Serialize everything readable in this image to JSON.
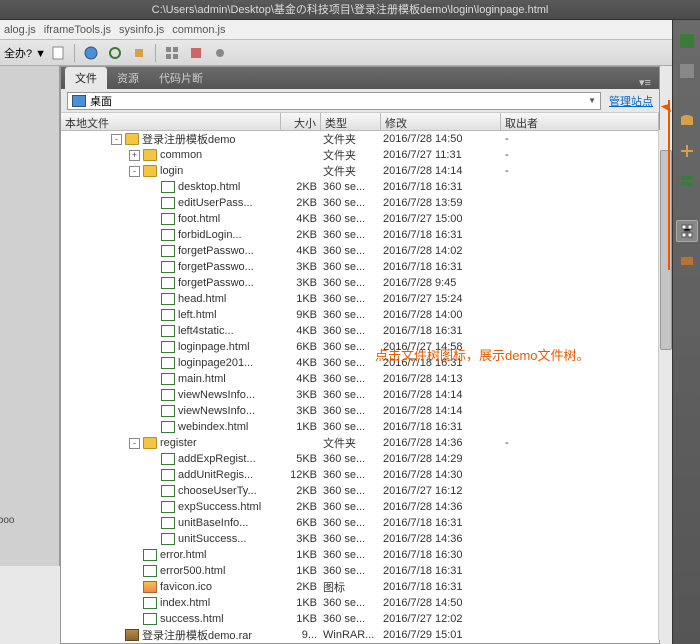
{
  "title_path": "C:\\Users\\admin\\Desktop\\基金の科技项目\\登录注册模板demo\\login\\loginpage.html",
  "open_files": [
    "alog.js",
    "iframeTools.js",
    "sysinfo.js",
    "common.js"
  ],
  "left_fragment": "全办? ▼",
  "left_bottom_fragment": "-login-boo",
  "panel_tabs": {
    "files": "文件",
    "resources": "资源",
    "snippets": "代码片断"
  },
  "location": {
    "label": "桌面",
    "manage": "管理站点"
  },
  "headers": {
    "name": "本地文件",
    "size": "大小",
    "type": "类型",
    "mod": "修改",
    "out": "取出者"
  },
  "annotation_text": "点击文件树图标，展示demo文件树。",
  "tree": [
    {
      "depth": 0,
      "twisty": "-",
      "icon": "folder-open",
      "name": "登录注册模板demo",
      "size": "",
      "type": "文件夹",
      "mod": "2016/7/28 14:50",
      "out": "-"
    },
    {
      "depth": 1,
      "twisty": "+",
      "icon": "folder",
      "name": "common",
      "size": "",
      "type": "文件夹",
      "mod": "2016/7/27 11:31",
      "out": "-"
    },
    {
      "depth": 1,
      "twisty": "-",
      "icon": "folder-open",
      "name": "login",
      "size": "",
      "type": "文件夹",
      "mod": "2016/7/28 14:14",
      "out": "-"
    },
    {
      "depth": 2,
      "twisty": "",
      "icon": "html",
      "name": "desktop.html",
      "size": "2KB",
      "type": "360 se...",
      "mod": "2016/7/18 16:31",
      "out": ""
    },
    {
      "depth": 2,
      "twisty": "",
      "icon": "html",
      "name": "editUserPass...",
      "size": "2KB",
      "type": "360 se...",
      "mod": "2016/7/28 13:59",
      "out": ""
    },
    {
      "depth": 2,
      "twisty": "",
      "icon": "html",
      "name": "foot.html",
      "size": "4KB",
      "type": "360 se...",
      "mod": "2016/7/27 15:00",
      "out": ""
    },
    {
      "depth": 2,
      "twisty": "",
      "icon": "html",
      "name": "forbidLogin...",
      "size": "2KB",
      "type": "360 se...",
      "mod": "2016/7/18 16:31",
      "out": ""
    },
    {
      "depth": 2,
      "twisty": "",
      "icon": "html",
      "name": "forgetPasswo...",
      "size": "4KB",
      "type": "360 se...",
      "mod": "2016/7/28 14:02",
      "out": ""
    },
    {
      "depth": 2,
      "twisty": "",
      "icon": "html",
      "name": "forgetPasswo...",
      "size": "3KB",
      "type": "360 se...",
      "mod": "2016/7/18 16:31",
      "out": ""
    },
    {
      "depth": 2,
      "twisty": "",
      "icon": "html",
      "name": "forgetPasswo...",
      "size": "3KB",
      "type": "360 se...",
      "mod": "2016/7/28 9:45",
      "out": ""
    },
    {
      "depth": 2,
      "twisty": "",
      "icon": "html",
      "name": "head.html",
      "size": "1KB",
      "type": "360 se...",
      "mod": "2016/7/27 15:24",
      "out": ""
    },
    {
      "depth": 2,
      "twisty": "",
      "icon": "html",
      "name": "left.html",
      "size": "9KB",
      "type": "360 se...",
      "mod": "2016/7/28 14:00",
      "out": ""
    },
    {
      "depth": 2,
      "twisty": "",
      "icon": "html",
      "name": "left4static...",
      "size": "4KB",
      "type": "360 se...",
      "mod": "2016/7/18 16:31",
      "out": ""
    },
    {
      "depth": 2,
      "twisty": "",
      "icon": "html",
      "name": "loginpage.html",
      "size": "6KB",
      "type": "360 se...",
      "mod": "2016/7/27 14:58",
      "out": ""
    },
    {
      "depth": 2,
      "twisty": "",
      "icon": "html",
      "name": "loginpage201...",
      "size": "4KB",
      "type": "360 se...",
      "mod": "2016/7/18 16:31",
      "out": ""
    },
    {
      "depth": 2,
      "twisty": "",
      "icon": "html",
      "name": "main.html",
      "size": "4KB",
      "type": "360 se...",
      "mod": "2016/7/28 14:13",
      "out": ""
    },
    {
      "depth": 2,
      "twisty": "",
      "icon": "html",
      "name": "viewNewsInfo...",
      "size": "3KB",
      "type": "360 se...",
      "mod": "2016/7/28 14:14",
      "out": ""
    },
    {
      "depth": 2,
      "twisty": "",
      "icon": "html",
      "name": "viewNewsInfo...",
      "size": "3KB",
      "type": "360 se...",
      "mod": "2016/7/28 14:14",
      "out": ""
    },
    {
      "depth": 2,
      "twisty": "",
      "icon": "html",
      "name": "webindex.html",
      "size": "1KB",
      "type": "360 se...",
      "mod": "2016/7/18 16:31",
      "out": ""
    },
    {
      "depth": 1,
      "twisty": "-",
      "icon": "folder-open",
      "name": "register",
      "size": "",
      "type": "文件夹",
      "mod": "2016/7/28 14:36",
      "out": "-"
    },
    {
      "depth": 2,
      "twisty": "",
      "icon": "html",
      "name": "addExpRegist...",
      "size": "5KB",
      "type": "360 se...",
      "mod": "2016/7/28 14:29",
      "out": ""
    },
    {
      "depth": 2,
      "twisty": "",
      "icon": "html",
      "name": "addUnitRegis...",
      "size": "12KB",
      "type": "360 se...",
      "mod": "2016/7/28 14:30",
      "out": ""
    },
    {
      "depth": 2,
      "twisty": "",
      "icon": "html",
      "name": "chooseUserTy...",
      "size": "2KB",
      "type": "360 se...",
      "mod": "2016/7/27 16:12",
      "out": ""
    },
    {
      "depth": 2,
      "twisty": "",
      "icon": "html",
      "name": "expSuccess.html",
      "size": "2KB",
      "type": "360 se...",
      "mod": "2016/7/28 14:36",
      "out": ""
    },
    {
      "depth": 2,
      "twisty": "",
      "icon": "html",
      "name": "unitBaseInfo...",
      "size": "6KB",
      "type": "360 se...",
      "mod": "2016/7/18 16:31",
      "out": ""
    },
    {
      "depth": 2,
      "twisty": "",
      "icon": "html",
      "name": "unitSuccess...",
      "size": "3KB",
      "type": "360 se...",
      "mod": "2016/7/28 14:36",
      "out": ""
    },
    {
      "depth": 1,
      "twisty": "",
      "icon": "html",
      "name": "error.html",
      "size": "1KB",
      "type": "360 se...",
      "mod": "2016/7/18 16:30",
      "out": ""
    },
    {
      "depth": 1,
      "twisty": "",
      "icon": "html",
      "name": "error500.html",
      "size": "1KB",
      "type": "360 se...",
      "mod": "2016/7/18 16:31",
      "out": ""
    },
    {
      "depth": 1,
      "twisty": "",
      "icon": "ico",
      "name": "favicon.ico",
      "size": "2KB",
      "type": "图标",
      "mod": "2016/7/18 16:31",
      "out": ""
    },
    {
      "depth": 1,
      "twisty": "",
      "icon": "html",
      "name": "index.html",
      "size": "1KB",
      "type": "360 se...",
      "mod": "2016/7/28 14:50",
      "out": ""
    },
    {
      "depth": 1,
      "twisty": "",
      "icon": "html",
      "name": "success.html",
      "size": "1KB",
      "type": "360 se...",
      "mod": "2016/7/27 12:02",
      "out": ""
    },
    {
      "depth": 0,
      "twisty": "",
      "icon": "rar",
      "name": "登录注册模板demo.rar",
      "size": "9...",
      "type": "WinRAR...",
      "mod": "2016/7/29 15:01",
      "out": ""
    }
  ]
}
